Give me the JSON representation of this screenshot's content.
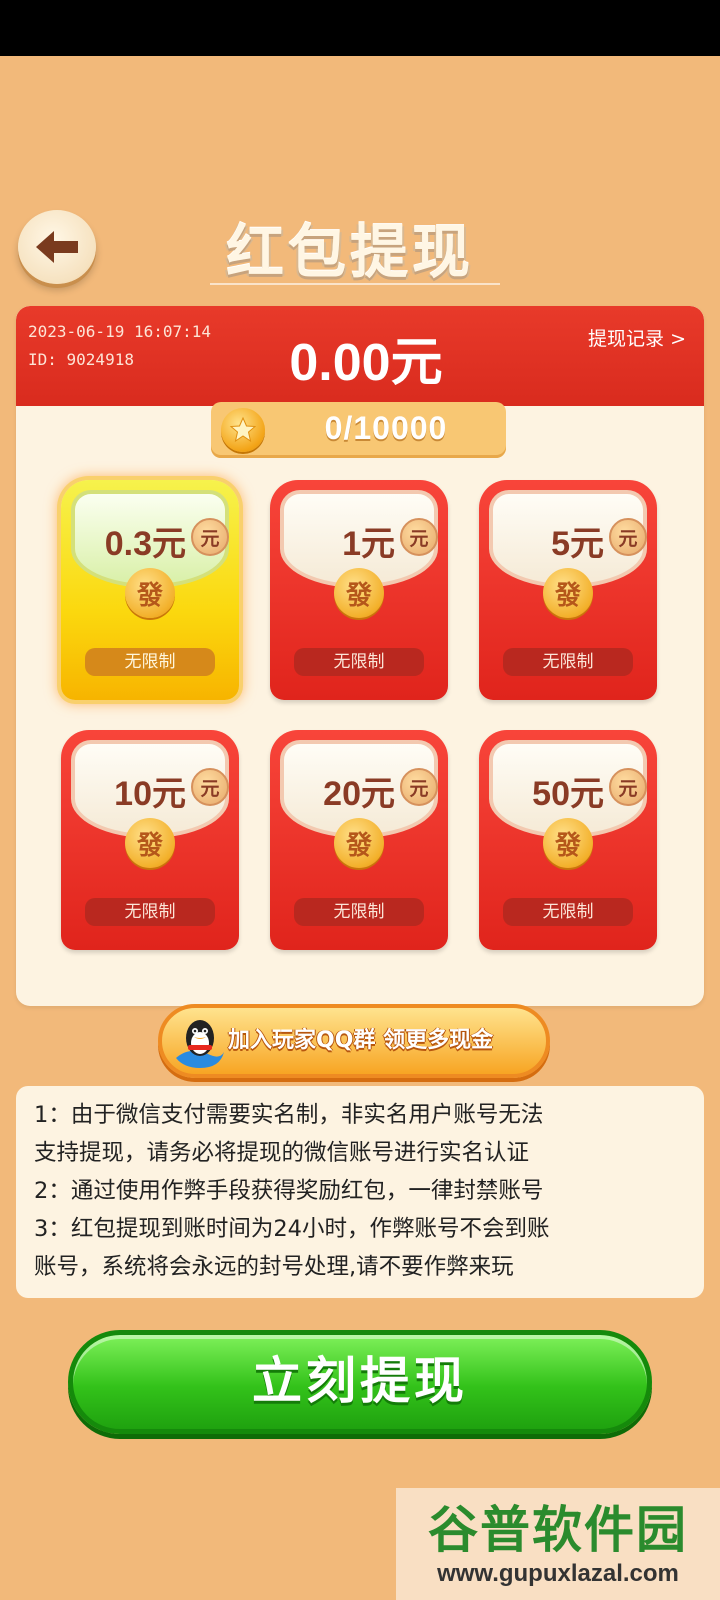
{
  "header": {
    "title": "红包提现",
    "back_label": "back"
  },
  "account": {
    "datetime": "2023-06-19 16:07:14",
    "id": "ID:  9024918",
    "balance": "0.00元",
    "records_link": "提现记录 >"
  },
  "coins": {
    "progress_text": "0/10000",
    "current": 0,
    "target": 10000
  },
  "envelopes": [
    {
      "amount": "0.3元",
      "badge": "元",
      "fa": "發",
      "limit": "无限制",
      "selected": true
    },
    {
      "amount": "1元",
      "badge": "元",
      "fa": "發",
      "limit": "无限制",
      "selected": false
    },
    {
      "amount": "5元",
      "badge": "元",
      "fa": "發",
      "limit": "无限制",
      "selected": false
    },
    {
      "amount": "10元",
      "badge": "元",
      "fa": "發",
      "limit": "无限制",
      "selected": false
    },
    {
      "amount": "20元",
      "badge": "元",
      "fa": "發",
      "limit": "无限制",
      "selected": false
    },
    {
      "amount": "50元",
      "badge": "元",
      "fa": "發",
      "limit": "无限制",
      "selected": false
    }
  ],
  "qq_group": {
    "label": "加入玩家QQ群  领更多现金"
  },
  "notice": {
    "lines": [
      "1：由于微信支付需要实名制，非实名用户账号无法",
      "支持提现，请务必将提现的微信账号进行实名认证",
      "2：通过使用作弊手段获得奖励红包，一律封禁账号",
      "3：红包提现到账时间为24小时，作弊账号不会到账",
      "账号，系统将会永远的封号处理,请不要作弊来玩"
    ]
  },
  "withdraw_button": {
    "label": "立刻提现"
  },
  "watermark": {
    "cn": "谷普软件园",
    "en": "www.gupuxlazal.com"
  },
  "colors": {
    "background": "#f2b97a",
    "header_red": "#e83a2a",
    "button_green": "#33c21a",
    "selected_yellow": "#fbd80e"
  }
}
